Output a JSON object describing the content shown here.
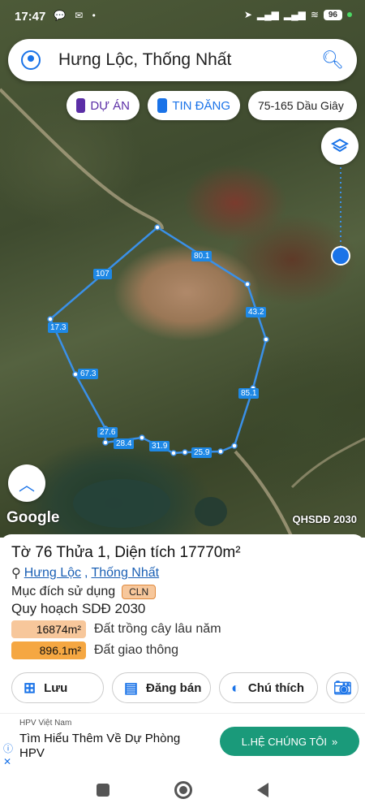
{
  "status": {
    "time": "17:47",
    "left_icons": "💬 ✉ •",
    "battery": "96"
  },
  "search": {
    "query": "Hưng Lộc, Thống Nhất"
  },
  "chips": {
    "du_an": "DỰ ÁN",
    "tin_dang": "TIN ĐĂNG",
    "location": "75-165 Dầu Giây"
  },
  "map": {
    "google_label": "Google",
    "plan_label": "QHSDĐ 2030",
    "edge_labels": [
      "80.1",
      "43.2",
      "85.1",
      "25.9",
      "31.9",
      "28.4",
      "27.6",
      "67.3",
      "17.3",
      "107"
    ]
  },
  "parcel": {
    "title": "Tờ 76 Thửa 1, Diện tích 17770m²",
    "commune": "Hưng Lộc",
    "separator": ", ",
    "district": "Thống Nhất",
    "purpose_label": "Mục đích sử dụng",
    "purpose_code": "CLN",
    "plan_title": "Quy hoạch SDĐ 2030",
    "legend": [
      {
        "value": "16874m²",
        "label": "Đất trồng cây lâu năm",
        "color": "#f7c79b"
      },
      {
        "value": "896.1m²",
        "label": "Đất giao thông",
        "color": "#f5a742"
      }
    ]
  },
  "actions": {
    "save": "Lưu",
    "sell": "Đăng bán",
    "note": "Chú thích"
  },
  "ad": {
    "sponsor": "HPV Việt Nam",
    "headline": "Tìm Hiểu Thêm Về Dự Phòng HPV",
    "cta": "L.HỆ CHÚNG TÔI"
  }
}
